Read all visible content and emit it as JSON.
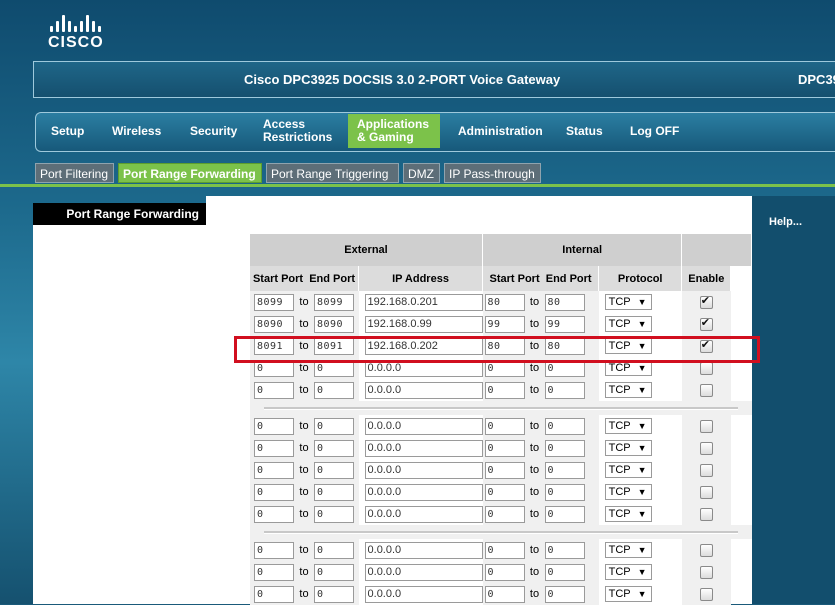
{
  "brand": {
    "name": "CISCO"
  },
  "header": {
    "title": "Cisco DPC3925 DOCSIS 3.0 2-PORT Voice Gateway",
    "title_right": "DPC39"
  },
  "nav": {
    "items": [
      "Setup",
      "Wireless",
      "Security",
      "Access\nRestrictions",
      "Applications\n& Gaming",
      "Administration",
      "Status",
      "Log OFF"
    ],
    "active": "Applications & Gaming"
  },
  "subtabs": {
    "items": [
      "Port Filtering",
      "Port Range Forwarding",
      "Port Range Triggering",
      "DMZ",
      "IP Pass-through"
    ],
    "active": "Port Range Forwarding"
  },
  "sidebar": {
    "heading": "Port Range Forwarding"
  },
  "help": {
    "label": "Help..."
  },
  "table": {
    "group_headers": [
      "External",
      "Internal"
    ],
    "column_headers": [
      "Start Port",
      "End Port",
      "IP Address",
      "Start Port",
      "End Port",
      "Protocol",
      "Enable"
    ],
    "to_label": "to",
    "rows": [
      {
        "ext_start": "8099",
        "ext_end": "8099",
        "ip": "192.168.0.201",
        "int_start": "80",
        "int_end": "80",
        "protocol": "TCP",
        "enabled": true
      },
      {
        "ext_start": "8090",
        "ext_end": "8090",
        "ip": "192.168.0.99",
        "int_start": "99",
        "int_end": "99",
        "protocol": "TCP",
        "enabled": true
      },
      {
        "ext_start": "8091",
        "ext_end": "8091",
        "ip": "192.168.0.202",
        "int_start": "80",
        "int_end": "80",
        "protocol": "TCP",
        "enabled": true
      },
      {
        "ext_start": "0",
        "ext_end": "0",
        "ip": "0.0.0.0",
        "int_start": "0",
        "int_end": "0",
        "protocol": "TCP",
        "enabled": false
      },
      {
        "ext_start": "0",
        "ext_end": "0",
        "ip": "0.0.0.0",
        "int_start": "0",
        "int_end": "0",
        "protocol": "TCP",
        "enabled": false
      },
      {
        "separator": true
      },
      {
        "ext_start": "0",
        "ext_end": "0",
        "ip": "0.0.0.0",
        "int_start": "0",
        "int_end": "0",
        "protocol": "TCP",
        "enabled": false
      },
      {
        "ext_start": "0",
        "ext_end": "0",
        "ip": "0.0.0.0",
        "int_start": "0",
        "int_end": "0",
        "protocol": "TCP",
        "enabled": false
      },
      {
        "ext_start": "0",
        "ext_end": "0",
        "ip": "0.0.0.0",
        "int_start": "0",
        "int_end": "0",
        "protocol": "TCP",
        "enabled": false
      },
      {
        "ext_start": "0",
        "ext_end": "0",
        "ip": "0.0.0.0",
        "int_start": "0",
        "int_end": "0",
        "protocol": "TCP",
        "enabled": false
      },
      {
        "ext_start": "0",
        "ext_end": "0",
        "ip": "0.0.0.0",
        "int_start": "0",
        "int_end": "0",
        "protocol": "TCP",
        "enabled": false
      },
      {
        "separator": true
      },
      {
        "ext_start": "0",
        "ext_end": "0",
        "ip": "0.0.0.0",
        "int_start": "0",
        "int_end": "0",
        "protocol": "TCP",
        "enabled": false
      },
      {
        "ext_start": "0",
        "ext_end": "0",
        "ip": "0.0.0.0",
        "int_start": "0",
        "int_end": "0",
        "protocol": "TCP",
        "enabled": false
      },
      {
        "ext_start": "0",
        "ext_end": "0",
        "ip": "0.0.0.0",
        "int_start": "0",
        "int_end": "0",
        "protocol": "TCP",
        "enabled": false
      }
    ]
  },
  "colors": {
    "accent_green": "#7cc24a",
    "highlight_red": "#d10f1f",
    "background_blue": "#1d6a8d"
  }
}
